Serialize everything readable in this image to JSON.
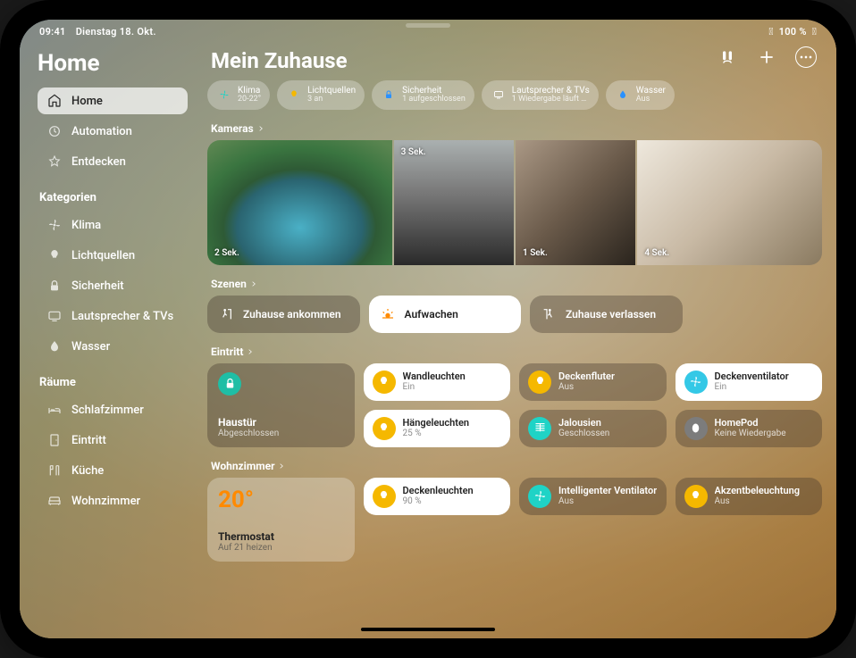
{
  "status": {
    "time": "09:41",
    "date": "Dienstag 18. Okt.",
    "battery": "100 %"
  },
  "sidebar": {
    "title": "Home",
    "nav": [
      {
        "label": "Home",
        "icon": "home"
      },
      {
        "label": "Automation",
        "icon": "automation"
      },
      {
        "label": "Entdecken",
        "icon": "star"
      }
    ],
    "catHeader": "Kategorien",
    "categories": [
      {
        "label": "Klima",
        "icon": "fan"
      },
      {
        "label": "Lichtquellen",
        "icon": "bulb"
      },
      {
        "label": "Sicherheit",
        "icon": "lock"
      },
      {
        "label": "Lautsprecher & TVs",
        "icon": "tv"
      },
      {
        "label": "Wasser",
        "icon": "drop"
      }
    ],
    "roomsHeader": "Räume",
    "rooms": [
      {
        "label": "Schlafzimmer",
        "icon": "bed"
      },
      {
        "label": "Eintritt",
        "icon": "door"
      },
      {
        "label": "Küche",
        "icon": "kitchen"
      },
      {
        "label": "Wohnzimmer",
        "icon": "sofa"
      }
    ]
  },
  "main": {
    "title": "Mein Zuhause",
    "chips": [
      {
        "label": "Klima",
        "sub": "20-22°",
        "icon": "fan",
        "color": "#1fd3c6"
      },
      {
        "label": "Lichtquellen",
        "sub": "3 an",
        "icon": "bulb",
        "color": "#f5b800"
      },
      {
        "label": "Sicherheit",
        "sub": "1 aufgeschlossen",
        "icon": "lock",
        "color": "#2a91ff"
      },
      {
        "label": "Lautsprecher & TVs",
        "sub": "1 Wiedergabe läuft …",
        "icon": "tv",
        "color": "#ffffff"
      },
      {
        "label": "Wasser",
        "sub": "Aus",
        "icon": "drop",
        "color": "#2a91ff"
      }
    ],
    "sections": {
      "cameras": {
        "header": "Kameras",
        "items": [
          "2 Sek.",
          "1 Sek.",
          "3 Sek.",
          "4 Sek."
        ]
      },
      "scenes": {
        "header": "Szenen",
        "items": [
          {
            "label": "Zuhause ankommen",
            "icon": "arrive",
            "light": false
          },
          {
            "label": "Aufwachen",
            "icon": "sunrise",
            "light": true
          },
          {
            "label": "Zuhause verlassen",
            "icon": "leave",
            "light": false
          }
        ]
      },
      "eintritt": {
        "header": "Eintritt",
        "big": {
          "name": "Haustür",
          "status": "Abgeschlossen",
          "icon": "lock",
          "color": "#1fbea5"
        },
        "tiles": [
          {
            "name": "Wandleuchten",
            "status": "Ein",
            "icon": "bulb",
            "bg": "yellow",
            "light": true
          },
          {
            "name": "Deckenfluter",
            "status": "Aus",
            "icon": "bulb",
            "bg": "yellow",
            "light": false
          },
          {
            "name": "Deckenventilator",
            "status": "Ein",
            "icon": "fan",
            "bg": "cyan",
            "light": true
          },
          {
            "name": "Hängeleuchten",
            "status": "25 %",
            "icon": "bulb",
            "bg": "yellow",
            "light": true
          },
          {
            "name": "Jalousien",
            "status": "Geschlossen",
            "icon": "blinds",
            "bg": "teal",
            "light": false
          },
          {
            "name": "HomePod",
            "status": "Keine Wiedergabe",
            "icon": "homepod",
            "bg": "grey",
            "light": false
          }
        ]
      },
      "wohnzimmer": {
        "header": "Wohnzimmer",
        "big": {
          "value": "20°",
          "name": "Thermostat",
          "status": "Auf 21 heizen"
        },
        "tiles": [
          {
            "name": "Deckenleuchten",
            "status": "90 %",
            "icon": "bulb",
            "bg": "yellow",
            "light": true
          },
          {
            "name": "Intelligenter Ventilator",
            "status": "Aus",
            "icon": "fan",
            "bg": "teal",
            "light": false
          },
          {
            "name": "Akzentbeleuchtung",
            "status": "Aus",
            "icon": "bulb",
            "bg": "yellow",
            "light": false
          }
        ]
      }
    }
  }
}
